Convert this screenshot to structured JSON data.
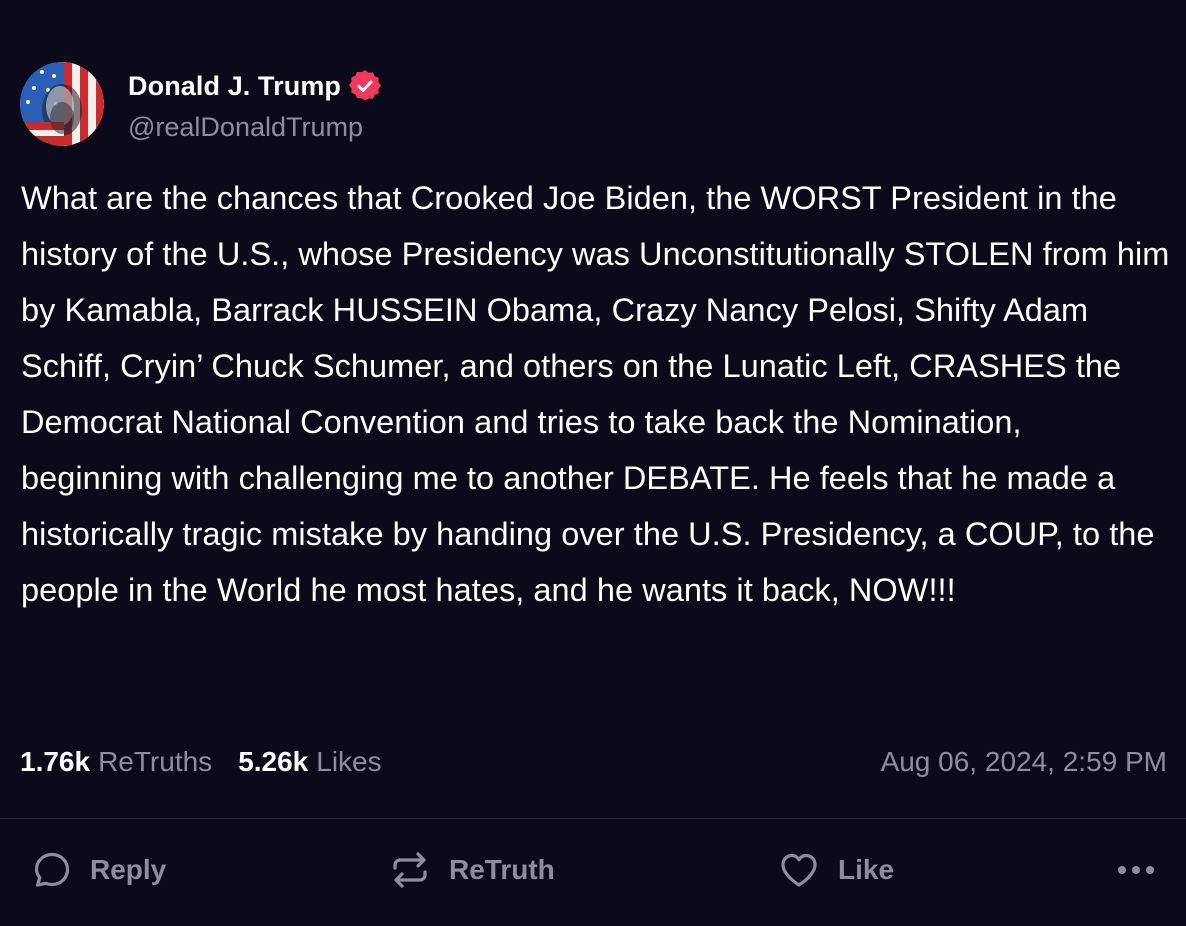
{
  "post": {
    "author": {
      "display_name": "Donald J. Trump",
      "handle": "@realDonaldTrump",
      "verified_icon": "verified-badge-icon",
      "avatar_icon": "flag-portrait-avatar"
    },
    "text": "What are the chances that Crooked Joe Biden, the WORST President in the history of the U.S., whose Presidency was Unconstitutionally STOLEN from him by Kamabla, Barrack HUSSEIN Obama, Crazy Nancy Pelosi, Shifty Adam Schiff, Cryin’ Chuck Schumer, and others on the Lunatic Left, CRASHES the Democrat National Convention and tries to take back the Nomination, beginning with challenging me to another DEBATE. He feels that he made a historically tragic mistake by handing over the U.S. Presidency, a COUP, to the people in the World he most hates, and he wants it back, NOW!!!",
    "stats": {
      "retruths_count": "1.76k",
      "retruths_label": "ReTruths",
      "likes_count": "5.26k",
      "likes_label": "Likes"
    },
    "timestamp": "Aug 06, 2024, 2:59 PM"
  },
  "actions": {
    "reply": {
      "label": "Reply",
      "icon": "reply-bubble-icon"
    },
    "retruth": {
      "label": "ReTruth",
      "icon": "retruth-arrows-icon"
    },
    "like": {
      "label": "Like",
      "icon": "heart-icon"
    },
    "more": {
      "icon": "more-dots-icon"
    }
  },
  "colors": {
    "background": "#0b0a1a",
    "text_primary": "#ffffff",
    "text_secondary": "#8e8c9e",
    "verified_badge": "#f2395b",
    "divider": "#2c2a3e"
  }
}
